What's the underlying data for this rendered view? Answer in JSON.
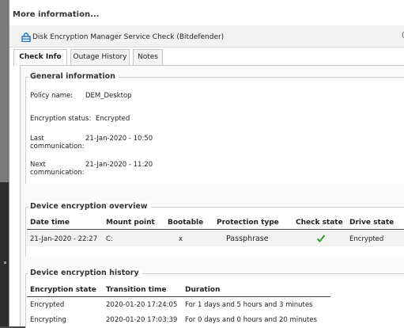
{
  "window": {
    "title": "More information..."
  },
  "service": {
    "name": "Disk Encryption Manager Service Check (Bitdefender)",
    "right_glyph": "("
  },
  "tabs": [
    {
      "label": "Check Info",
      "active": true
    },
    {
      "label": "Outage History",
      "active": false
    },
    {
      "label": "Notes",
      "active": false
    }
  ],
  "general": {
    "title": "General information",
    "policy_label": "Policy name:",
    "policy_value": "DEM_Desktop",
    "status_label": "Encryption status:",
    "status_value": "Encrypted",
    "last_label_1": "Last",
    "last_label_2": "communication:",
    "last_value": "21-Jan-2020 - 10:50",
    "next_label_1": "Next",
    "next_label_2": "communication:",
    "next_value": "21-Jan-2020 - 11:20"
  },
  "overview": {
    "title": "Device encryption overview",
    "headers": [
      "Date time",
      "Mount point",
      "Bootable",
      "Protection type",
      "Check state",
      "Drive state"
    ],
    "row": {
      "date": "21-Jan-2020 - 22:27",
      "mount": "C:",
      "bootable": "x",
      "protection": "Passphrase",
      "check_icon": "check-icon",
      "drive": "Encrypted"
    }
  },
  "history": {
    "title": "Device encryption history",
    "headers": [
      "Encryption state",
      "Transition time",
      "Duration"
    ],
    "rows": [
      {
        "state": "Encrypted",
        "time": "2020-01-20 17:24:05",
        "duration": "For 1 days and 5 hours and 3 minutes"
      },
      {
        "state": "Encrypting",
        "time": "2020-01-20 17:03:39",
        "duration": "For 0 days and 0 hours and 20 minutes"
      }
    ]
  },
  "colors": {
    "accent": "#1e6fc4",
    "check": "#2e9e2e"
  }
}
